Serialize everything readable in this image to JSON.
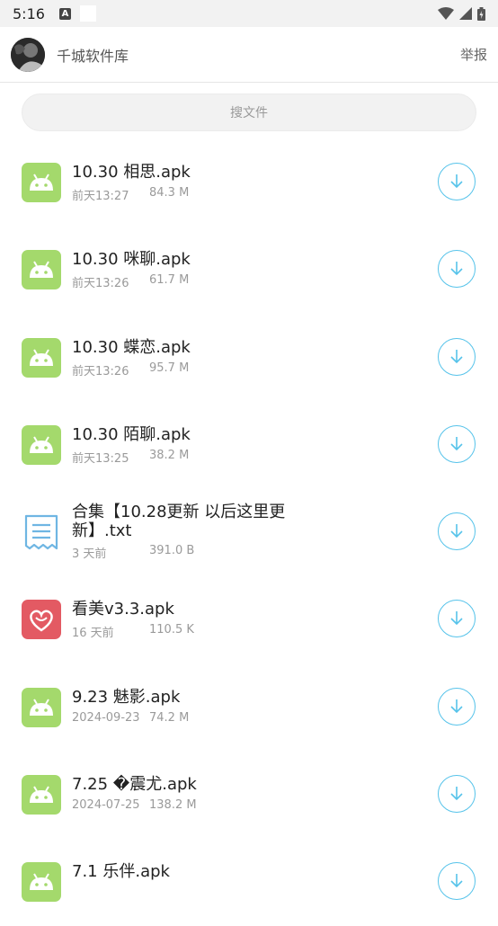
{
  "status": {
    "time": "5:16",
    "a_badge": "A"
  },
  "header": {
    "title": "千城软件库",
    "report": "举报"
  },
  "search": {
    "placeholder": "搜文件"
  },
  "files": [
    {
      "name": "10.30 相思.apk",
      "date": "前天13:27",
      "size": "84.3 M",
      "icon": "android-icon"
    },
    {
      "name": "10.30 咪聊.apk",
      "date": "前天13:26",
      "size": "61.7 M",
      "icon": "android-icon"
    },
    {
      "name": "10.30 蝶恋.apk",
      "date": "前天13:26",
      "size": "95.7 M",
      "icon": "android-icon"
    },
    {
      "name": "10.30 陌聊.apk",
      "date": "前天13:25",
      "size": "38.2 M",
      "icon": "android-icon"
    },
    {
      "name": "合集【10.28更新 以后这里更新】.txt",
      "date": "3 天前",
      "size": "391.0 B",
      "icon": "text-file-icon"
    },
    {
      "name": "看美v3.3.apk",
      "date": "16 天前",
      "size": "110.5 K",
      "icon": "app-heart-icon"
    },
    {
      "name": "9.23 魅影.apk",
      "date": "2024-09-23",
      "size": "74.2 M",
      "icon": "android-icon"
    },
    {
      "name": "7.25 �震尤.apk",
      "date": "2024-07-25",
      "size": "138.2 M",
      "icon": "android-icon"
    },
    {
      "name": "7.1 乐伴.apk",
      "date": "",
      "size": "",
      "icon": "android-icon"
    }
  ],
  "colors": {
    "android_green": "#a4d96c",
    "download_blue": "#56c3ea",
    "heart_red": "#e35a63"
  }
}
